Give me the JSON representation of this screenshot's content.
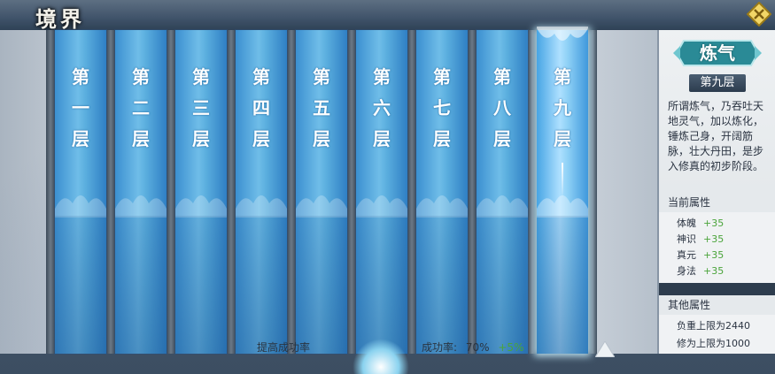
{
  "header": {
    "title": "境界"
  },
  "layers": [
    {
      "label": "第\n一\n层",
      "active": false
    },
    {
      "label": "第\n二\n层",
      "active": false
    },
    {
      "label": "第\n三\n层",
      "active": false
    },
    {
      "label": "第\n四\n层",
      "active": false
    },
    {
      "label": "第\n五\n层",
      "active": false
    },
    {
      "label": "第\n六\n层",
      "active": false
    },
    {
      "label": "第\n七\n层",
      "active": false
    },
    {
      "label": "第\n八\n层",
      "active": false
    },
    {
      "label": "第\n九\n层",
      "active": true
    }
  ],
  "bottom": {
    "improve_label": "提高成功率",
    "rate_label": "成功率:",
    "rate_value": "70%",
    "rate_bonus": "+5%"
  },
  "panel": {
    "realm_name": "炼气",
    "layer_tag": "第九层",
    "description": "所谓炼气，乃吞吐天地灵气，加以炼化，锤炼己身，开阔筋脉，壮大丹田，是步入修真的初步阶段。",
    "current_attrs_title": "当前属性",
    "current_attrs": [
      {
        "name": "体魄",
        "value": "+35"
      },
      {
        "name": "神识",
        "value": "+35"
      },
      {
        "name": "真元",
        "value": "+35"
      },
      {
        "name": "身法",
        "value": "+35"
      }
    ],
    "other_attrs_title": "其他属性",
    "other_attrs": [
      {
        "text": "负重上限为2440"
      },
      {
        "text": "修为上限为1000"
      }
    ]
  },
  "colors": {
    "accent_green": "#4aa43a",
    "banner_blue": "#5aaede",
    "badge_teal": "#2a8a96"
  }
}
